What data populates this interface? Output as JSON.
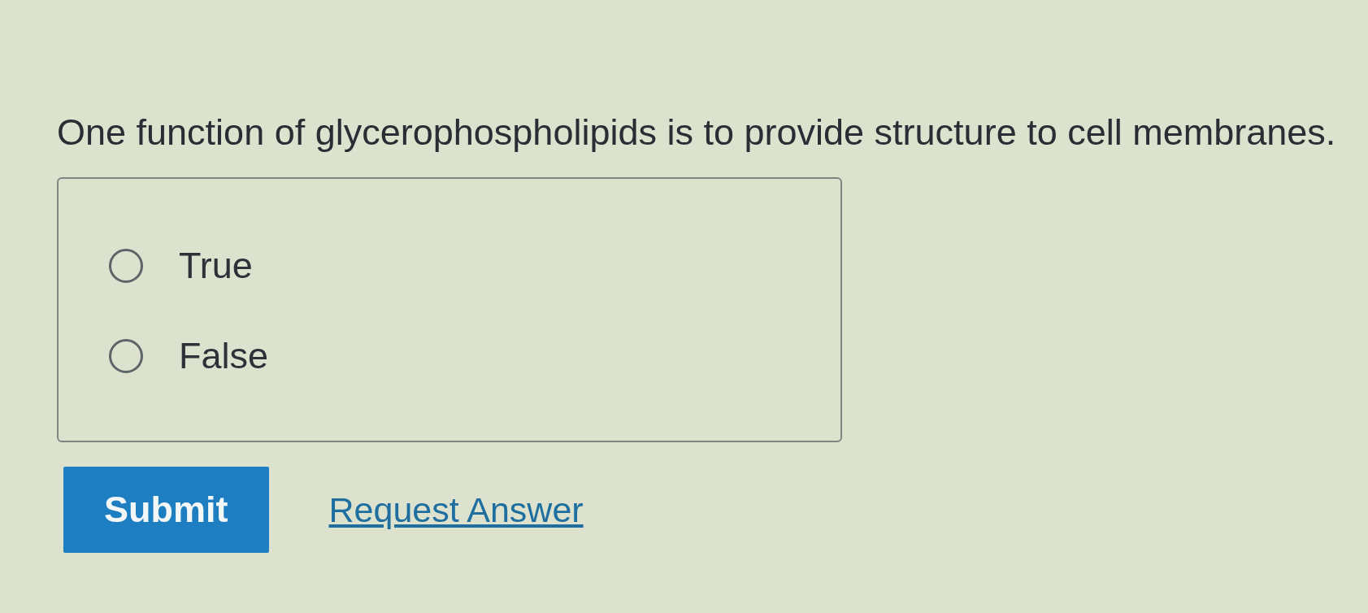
{
  "question": {
    "text": "One function of glycerophospholipids is to provide structure to cell membranes."
  },
  "options": [
    {
      "label": "True",
      "selected": false
    },
    {
      "label": "False",
      "selected": false
    }
  ],
  "submit_button": {
    "label": "Submit"
  },
  "request_answer_link": {
    "label": "Request Answer"
  }
}
